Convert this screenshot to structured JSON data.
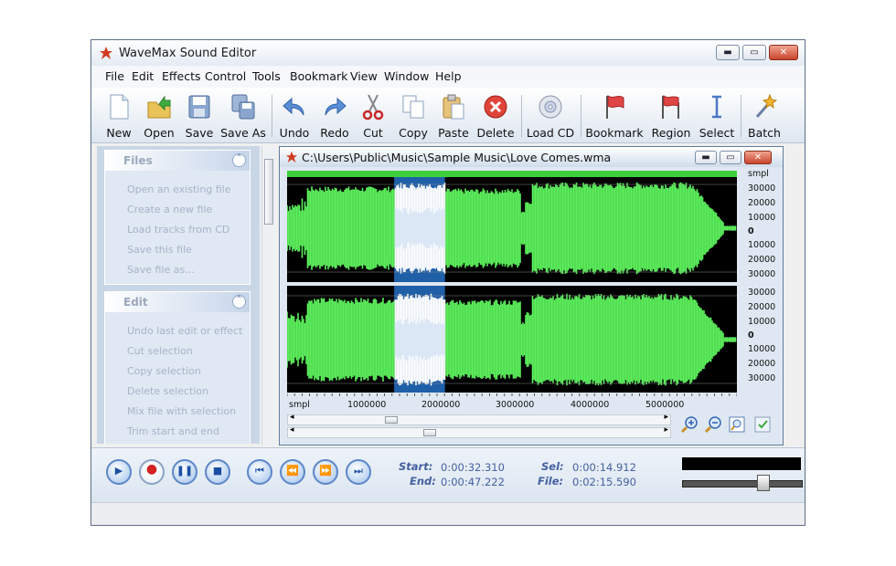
{
  "window": {
    "title": "WaveMax Sound Editor",
    "minimize_glyph": "▬",
    "maximize_glyph": "▭",
    "close_glyph": "✕"
  },
  "menu": [
    "File",
    "Edit",
    "Effects",
    "Control",
    "Tools",
    "Bookmark",
    "View",
    "Window",
    "Help"
  ],
  "toolbar": [
    {
      "label": "New",
      "icon": "new-file-icon"
    },
    {
      "label": "Open",
      "icon": "open-folder-icon"
    },
    {
      "label": "Save",
      "icon": "save-disk-icon"
    },
    {
      "label": "Save As",
      "icon": "save-as-icon"
    },
    {
      "label": "Undo",
      "icon": "undo-arrow-icon"
    },
    {
      "label": "Redo",
      "icon": "redo-arrow-icon"
    },
    {
      "label": "Cut",
      "icon": "scissors-icon"
    },
    {
      "label": "Copy",
      "icon": "copy-icon"
    },
    {
      "label": "Paste",
      "icon": "paste-icon"
    },
    {
      "label": "Delete",
      "icon": "delete-icon"
    },
    {
      "label": "Load CD",
      "icon": "cd-icon"
    },
    {
      "label": "Bookmark",
      "icon": "bookmark-flag-icon"
    },
    {
      "label": "Region",
      "icon": "region-flag-icon"
    },
    {
      "label": "Select",
      "icon": "select-cursor-icon"
    },
    {
      "label": "Batch",
      "icon": "batch-wand-icon"
    }
  ],
  "tasks": {
    "files": {
      "title": "Files",
      "toggle_glyph": "⌃",
      "items": [
        "Open an existing file",
        "Create a new file",
        "Load tracks from CD",
        "Save this file",
        "Save file as..."
      ]
    },
    "edit": {
      "title": "Edit",
      "toggle_glyph": "⌃",
      "items": [
        "Undo last edit or effect",
        "Cut selection",
        "Copy selection",
        "Delete selection",
        "Mix file with selection",
        "Trim start and end"
      ]
    }
  },
  "document": {
    "title": "C:\\Users\\Public\\Music\\Sample Music\\Love Comes.wma",
    "unit_label": "smpl",
    "y_ticks": [
      "30000",
      "20000",
      "10000",
      "0",
      "10000",
      "20000",
      "30000"
    ],
    "x_unit_label": "smpl",
    "x_ticks": [
      "1000000",
      "2000000",
      "3000000",
      "4000000",
      "5000000"
    ],
    "arrow_left": "◂",
    "arrow_right": "▸",
    "waveform_color": "#5cf05c",
    "selection_color": "#1f5fa8",
    "selection_fraction": [
      0.238,
      0.351
    ]
  },
  "transport": {
    "buttons": [
      {
        "name": "play",
        "glyph": "▶"
      },
      {
        "name": "record",
        "glyph": "●"
      },
      {
        "name": "pause",
        "glyph": "❚❚"
      },
      {
        "name": "stop",
        "glyph": "■"
      },
      {
        "name": "go-start",
        "glyph": "⏮"
      },
      {
        "name": "rewind",
        "glyph": "⏪"
      },
      {
        "name": "fast-forward",
        "glyph": "⏩"
      },
      {
        "name": "go-end",
        "glyph": "⏭"
      }
    ],
    "start_label": "Start:",
    "start_value": "0:00:32.310",
    "end_label": "End:",
    "end_value": "0:00:47.222",
    "sel_label": "Sel:",
    "sel_value": "0:00:14.912",
    "file_label": "File:",
    "file_value": "0:02:15.590",
    "volume_fraction": 0.66
  }
}
